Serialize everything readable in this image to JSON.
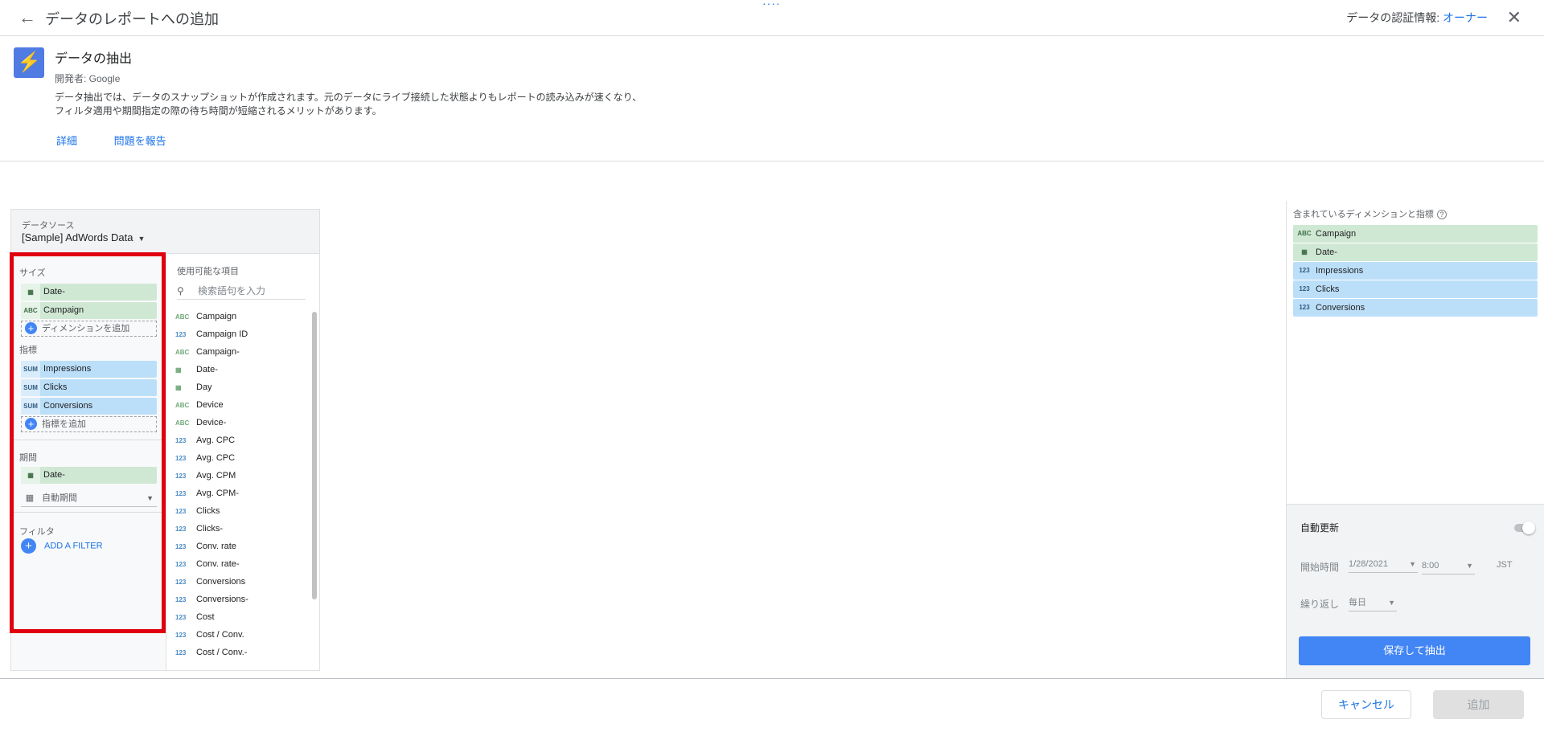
{
  "header": {
    "title": "データのレポートへの追加",
    "drag_handle": "····",
    "credential_label": "データの認証情報:",
    "credential_value": "オーナー"
  },
  "connector": {
    "name": "データの抽出",
    "developer": "開発者: Google",
    "description": "データ抽出では、データのスナップショットが作成されます。元のデータにライブ接続した状態よりもレポートの読み込みが速くなり、フィルタ適用や期間指定の際の待ち時間が短縮されるメリットがあります。",
    "links": [
      "詳細",
      "問題を報告"
    ]
  },
  "datasource": {
    "label": "データソース",
    "value": "[Sample] AdWords Data"
  },
  "config": {
    "dimensions_label": "サイズ",
    "dimensions": [
      {
        "type": "date",
        "icon": "calendar-icon",
        "label": "Date-"
      },
      {
        "type": "ABC",
        "icon": "text-type-icon",
        "label": "Campaign"
      }
    ],
    "add_dimension": "ディメンションを追加",
    "metrics_label": "指標",
    "metrics": [
      {
        "type": "SUM",
        "label": "Impressions"
      },
      {
        "type": "SUM",
        "label": "Clicks"
      },
      {
        "type": "SUM",
        "label": "Conversions"
      }
    ],
    "add_metric": "指標を追加",
    "period_label": "期間",
    "period_field": "Date-",
    "period_value": "自動期間",
    "filter_label": "フィルタ",
    "add_filter": "ADD A FILTER"
  },
  "available": {
    "header": "使用可能な項目",
    "search_placeholder": "検索語句を入力",
    "fields": [
      {
        "type": "ABC",
        "label": "Campaign"
      },
      {
        "type": "123",
        "label": "Campaign ID"
      },
      {
        "type": "ABC",
        "label": "Campaign-"
      },
      {
        "type": "date",
        "label": "Date-"
      },
      {
        "type": "date",
        "label": "Day"
      },
      {
        "type": "ABC",
        "label": "Device"
      },
      {
        "type": "ABC",
        "label": "Device-"
      },
      {
        "type": "123",
        "label": "Avg. CPC"
      },
      {
        "type": "123",
        "label": "Avg. CPC"
      },
      {
        "type": "123",
        "label": "Avg. CPM"
      },
      {
        "type": "123",
        "label": "Avg. CPM-"
      },
      {
        "type": "123",
        "label": "Clicks"
      },
      {
        "type": "123",
        "label": "Clicks-"
      },
      {
        "type": "123",
        "label": "Conv. rate"
      },
      {
        "type": "123",
        "label": "Conv. rate-"
      },
      {
        "type": "123",
        "label": "Conversions"
      },
      {
        "type": "123",
        "label": "Conversions-"
      },
      {
        "type": "123",
        "label": "Cost"
      },
      {
        "type": "123",
        "label": "Cost / Conv."
      },
      {
        "type": "123",
        "label": "Cost / Conv.-"
      }
    ]
  },
  "included": {
    "header": "含まれているディメンションと指標",
    "items": [
      {
        "type": "ABC",
        "kind": "dim",
        "label": "Campaign"
      },
      {
        "type": "date",
        "kind": "dim",
        "label": "Date-"
      },
      {
        "type": "123",
        "kind": "met",
        "label": "Impressions"
      },
      {
        "type": "123",
        "kind": "met",
        "label": "Clicks"
      },
      {
        "type": "123",
        "kind": "met",
        "label": "Conversions"
      }
    ]
  },
  "refresh": {
    "title": "自動更新",
    "start_label": "開始時間",
    "start_date": "1/28/2021",
    "start_time": "8:00",
    "timezone": "JST",
    "repeat_label": "繰り返し",
    "repeat_value": "毎日",
    "save_button": "保存して抽出"
  },
  "footer": {
    "cancel": "キャンセル",
    "add": "追加"
  }
}
